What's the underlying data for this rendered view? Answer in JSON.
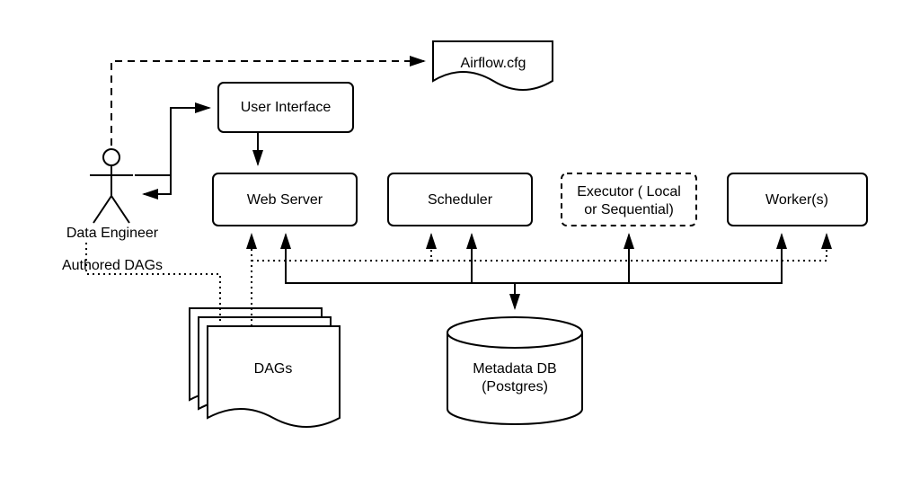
{
  "actor": "Data Engineer",
  "config": "Airflow.cfg",
  "ui": "User Interface",
  "webserver": "Web Server",
  "scheduler": "Scheduler",
  "executor_l1": "Executor ( Local",
  "executor_l2": "or Sequential)",
  "worker": "Worker(s)",
  "dags": "DAGs",
  "db_l1": "Metadata DB",
  "db_l2": "(Postgres)",
  "authored": "Authored DAGs"
}
